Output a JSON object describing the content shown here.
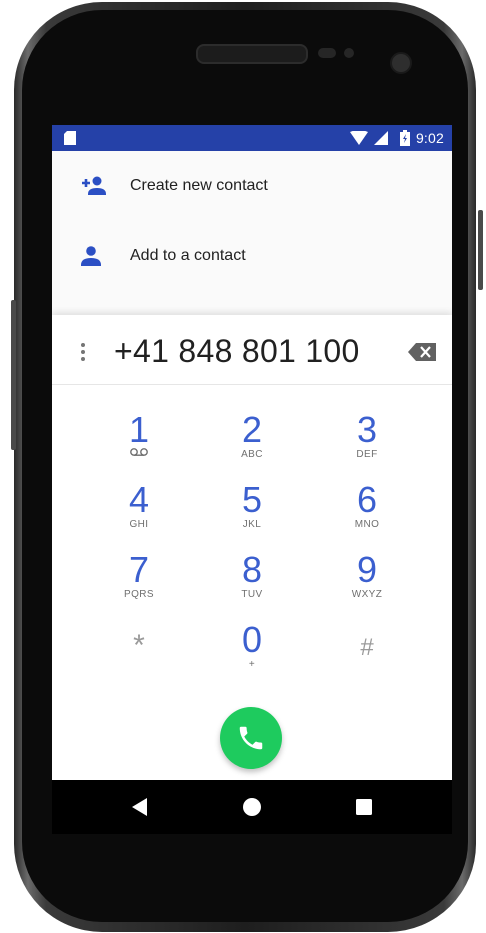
{
  "status_bar": {
    "time": "9:02",
    "icons": [
      "sd-card-icon",
      "wifi-icon",
      "signal-icon",
      "battery-icon"
    ],
    "color": "#2541a8"
  },
  "menu": {
    "create_contact_label": "Create new contact",
    "add_to_contact_label": "Add to a contact"
  },
  "dialer": {
    "number": "+41 848 801 100",
    "keys": [
      {
        "digit": "1",
        "letters": ""
      },
      {
        "digit": "2",
        "letters": "ABC"
      },
      {
        "digit": "3",
        "letters": "DEF"
      },
      {
        "digit": "4",
        "letters": "GHI"
      },
      {
        "digit": "5",
        "letters": "JKL"
      },
      {
        "digit": "6",
        "letters": "MNO"
      },
      {
        "digit": "7",
        "letters": "PQRS"
      },
      {
        "digit": "8",
        "letters": "TUV"
      },
      {
        "digit": "9",
        "letters": "WXYZ"
      },
      {
        "digit": "*",
        "letters": ""
      },
      {
        "digit": "0",
        "letters": "+"
      },
      {
        "digit": "#",
        "letters": ""
      }
    ]
  },
  "colors": {
    "accent": "#3b5fcf",
    "call_green": "#1ecb5e",
    "status_bar": "#2541a8"
  },
  "nav": {
    "icons": [
      "back-icon",
      "home-icon",
      "recents-icon"
    ]
  }
}
